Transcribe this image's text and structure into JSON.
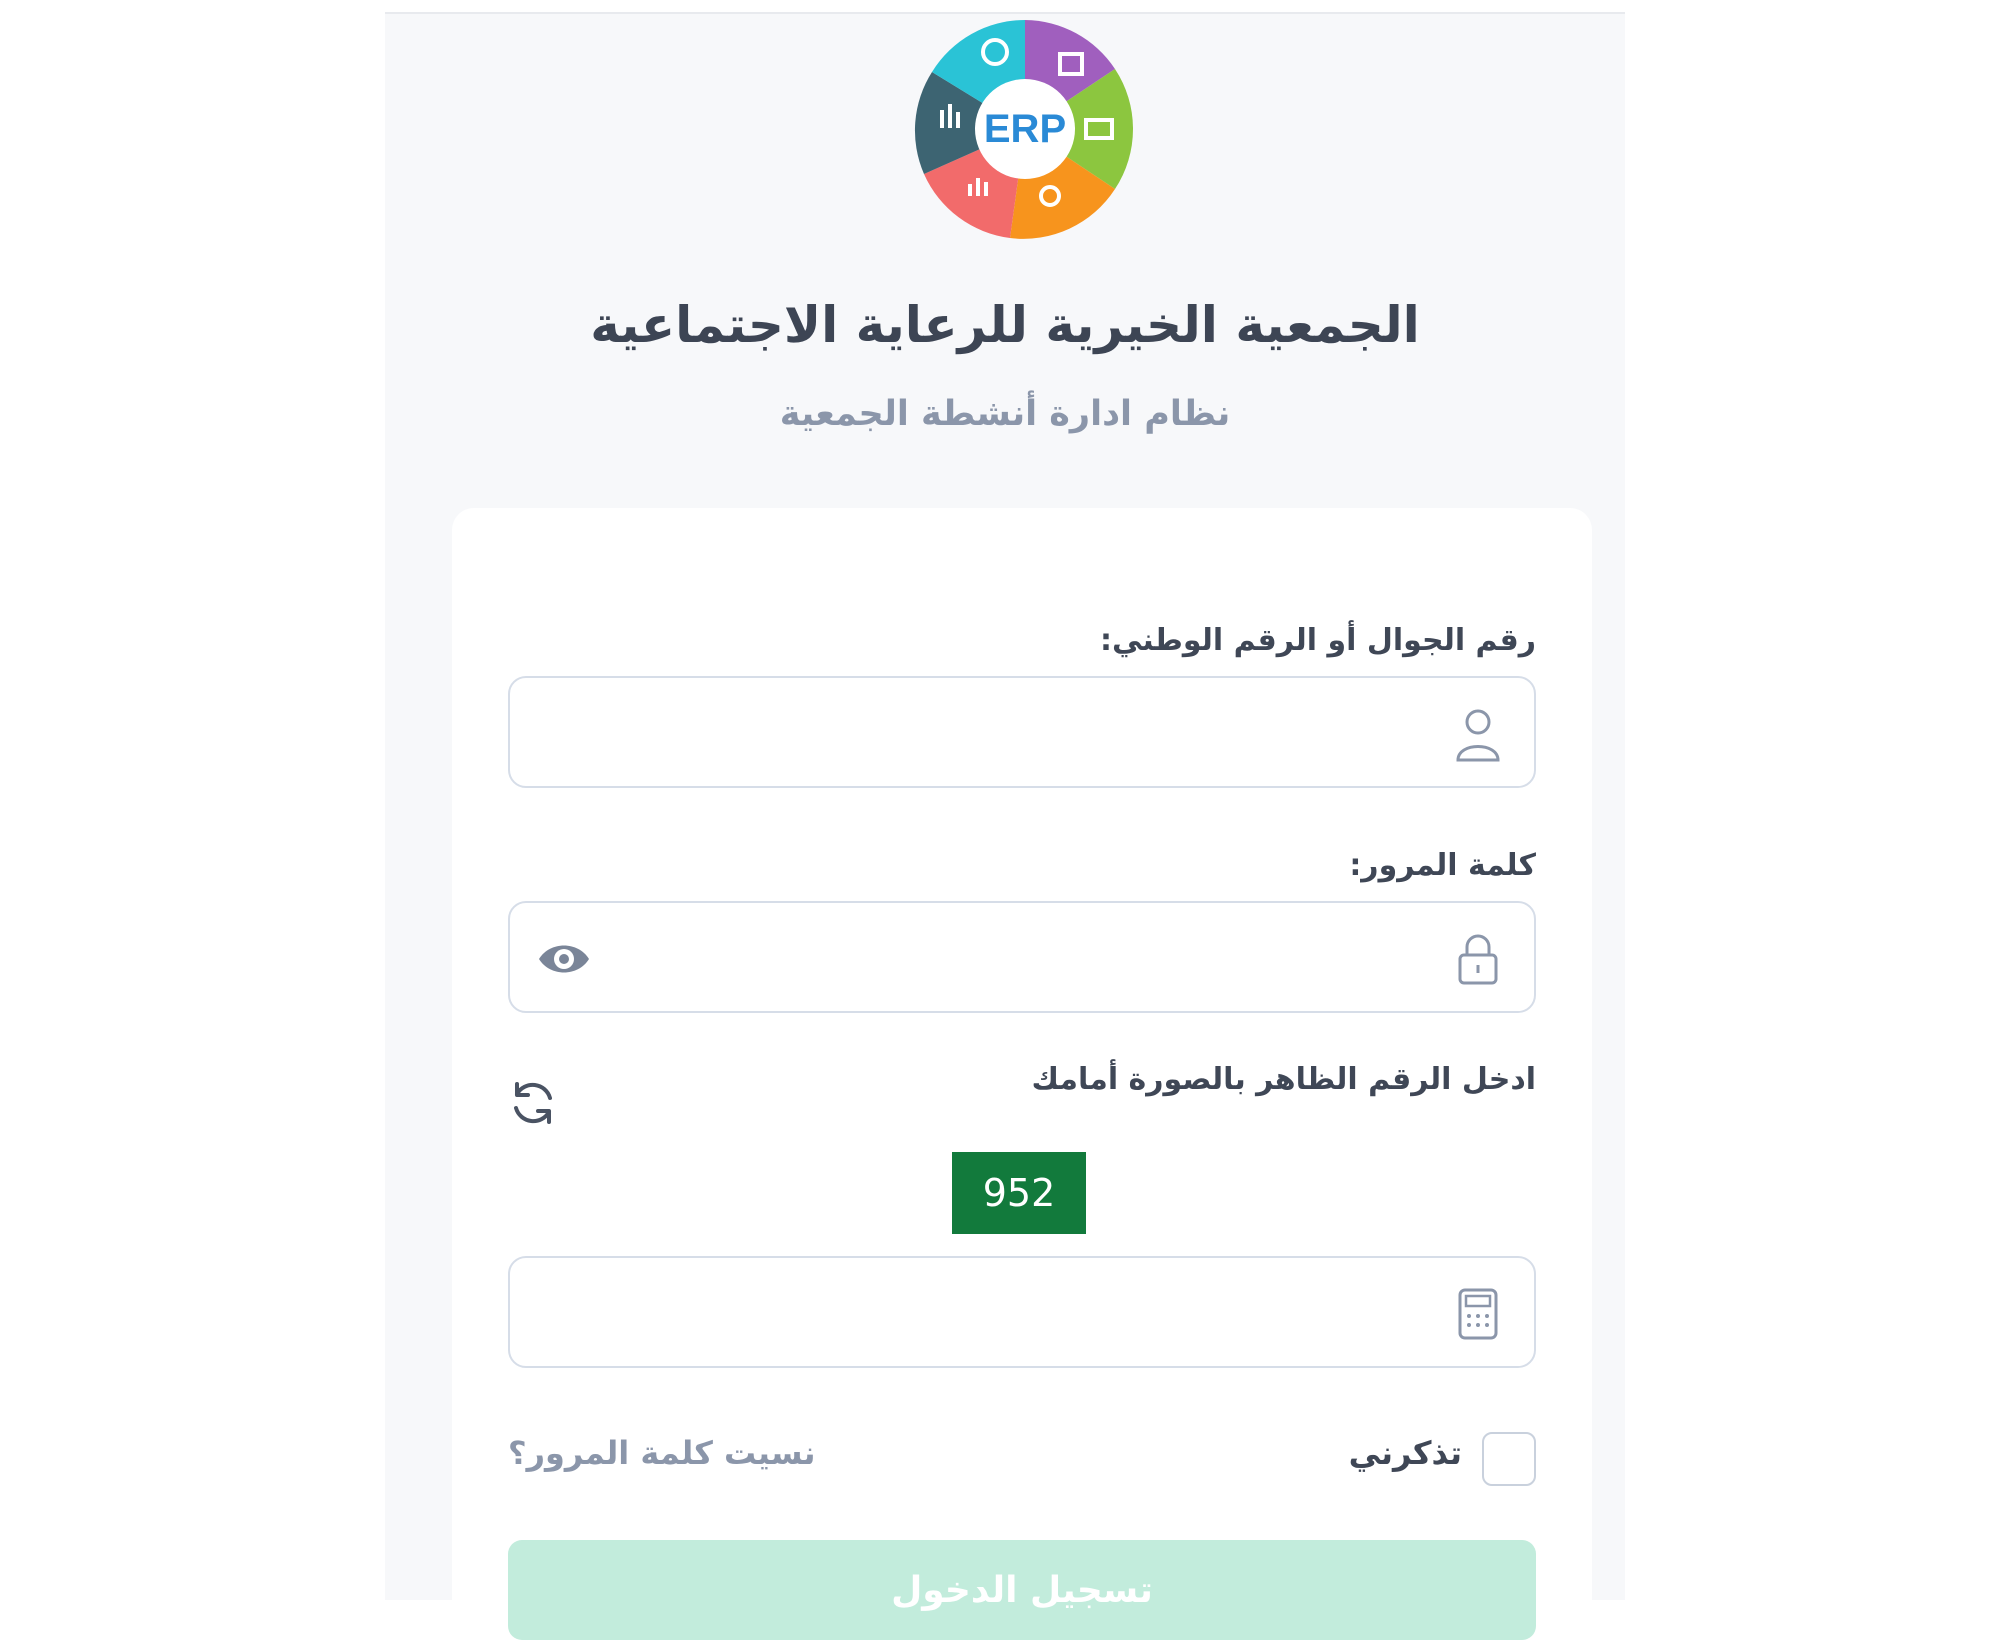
{
  "header": {
    "logo_text": "ERP",
    "title": "الجمعية الخيرية للرعاية الاجتماعية",
    "subtitle": "نظام ادارة أنشطة الجمعية"
  },
  "login_form": {
    "username_label": "رقم الجوال أو الرقم الوطني:",
    "username_value": "",
    "username_icon": "user-icon",
    "password_label": "كلمة المرور:",
    "password_value": "",
    "password_icon": "lock-icon",
    "show_password_icon": "eye-icon",
    "captcha_label": "ادخل الرقم الظاهر بالصورة أمامك",
    "captcha_code": "952",
    "captcha_refresh_icon": "refresh-icon",
    "captcha_value": "",
    "captcha_icon": "calculator-icon",
    "remember_label": "تذكرني",
    "remember_checked": false,
    "forgot_link": "نسيت كلمة المرور؟",
    "submit_label": "تسجيل الدخول"
  },
  "colors": {
    "captcha_bg": "#127a3c",
    "button_bg": "#c2ecdc",
    "title": "#3d4554",
    "subtitle": "#8b96aa"
  }
}
